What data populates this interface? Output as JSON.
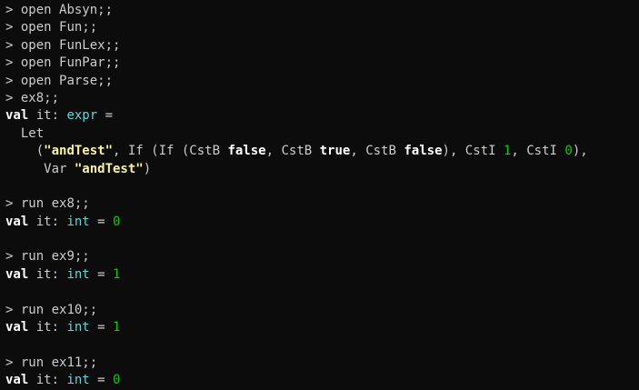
{
  "colors": {
    "background": "#0c0c0c",
    "text": "#cccccc",
    "keyword": "#ffffff",
    "type": "#61d6d6",
    "number": "#16c60c",
    "string": "#f9f1a5"
  },
  "prompt": ">",
  "commands": {
    "open_absyn": "open Absyn;;",
    "open_fun": "open Fun;;",
    "open_funlex": "open FunLex;;",
    "open_funpar": "open FunPar;;",
    "open_parse": "open Parse;;",
    "ex8": "ex8;;",
    "run_ex8": "run ex8;;",
    "run_ex9": "run ex9;;",
    "run_ex10": "run ex10;;",
    "run_ex11": "run ex11;;"
  },
  "output": {
    "val_kw": "val",
    "it_colon": " it: ",
    "equals": " =",
    "equals_space": " = ",
    "expr_type": "expr",
    "int_type": "int",
    "let_line": "  Let",
    "paren_open": "    (",
    "and_test_str": "\"andTest\"",
    "if_part": ", If (If (CstB ",
    "false1": "false",
    "cstb_sep1": ", CstB ",
    "true1": "true",
    "cstb_sep2": ", CstB ",
    "false2": "false",
    "csti_part1": "), CstI ",
    "one": "1",
    "csti_part2": ", CstI ",
    "zero": "0",
    "tail1": "),",
    "var_indent": "     Var ",
    "tail2": ")",
    "result_ex8": "0",
    "result_ex9": "1",
    "result_ex10": "1",
    "result_ex11": "0"
  }
}
